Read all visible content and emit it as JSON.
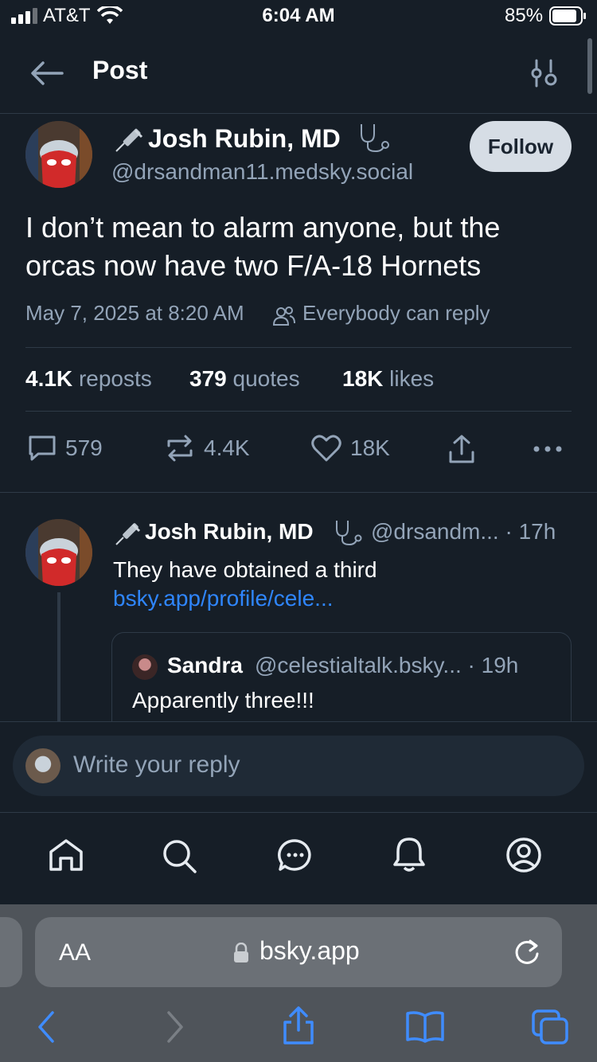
{
  "status_bar": {
    "carrier": "AT&T",
    "time": "6:04 AM",
    "battery": "85%"
  },
  "header": {
    "title": "Post"
  },
  "post": {
    "author_name": "Josh Rubin, MD",
    "author_handle": "@drsandman11.medsky.social",
    "follow_label": "Follow",
    "text": "I don’t mean to alarm anyone, but the orcas now have two F/A-18 Hornets",
    "timestamp": "May 7, 2025 at 8:20 AM",
    "reply_setting": "Everybody can reply",
    "stats": {
      "reposts_count": "4.1K",
      "reposts_label": "reposts",
      "quotes_count": "379",
      "quotes_label": "quotes",
      "likes_count": "18K",
      "likes_label": "likes"
    },
    "actions": {
      "replies": "579",
      "reposts": "4.4K",
      "likes": "18K"
    }
  },
  "reply": {
    "author_name": "Josh Rubin, MD",
    "author_handle": "@drsandm... · 17h",
    "text": "They have obtained a third",
    "link": "bsky.app/profile/cele...",
    "quote": {
      "author_name": "Sandra",
      "author_handle": "@celestialtalk.bsky... · 19h",
      "text": "Apparently three!!!"
    }
  },
  "composer": {
    "placeholder": "Write your reply"
  },
  "safari": {
    "aa_label": "AA",
    "url": "bsky.app"
  },
  "colors": {
    "background": "#161e27",
    "accent_link": "#2f86ff",
    "muted_text": "#93a4b8",
    "follow_button": "#d6dde5"
  },
  "icons": [
    "back-arrow-icon",
    "sliders-icon",
    "syringe-icon",
    "stethoscope-icon",
    "people-icon",
    "comment-icon",
    "repost-icon",
    "heart-icon",
    "share-icon",
    "more-icon",
    "home-icon",
    "search-icon",
    "chat-icon",
    "bell-icon",
    "profile-icon",
    "lock-icon",
    "reload-icon",
    "safari-back-icon",
    "safari-forward-icon",
    "safari-share-icon",
    "bookmarks-icon",
    "tabs-icon"
  ]
}
